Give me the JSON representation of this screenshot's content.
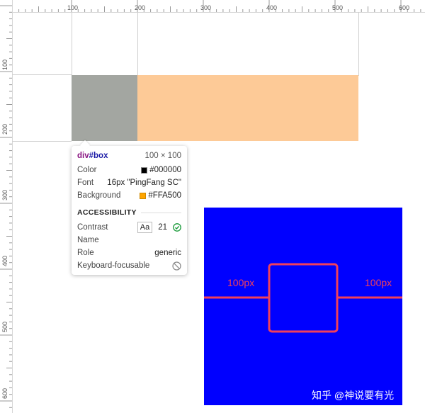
{
  "ruler": {
    "top_labels": [
      "100",
      "200",
      "300",
      "400",
      "500",
      "600"
    ],
    "left_labels": [
      "100",
      "200",
      "300",
      "400",
      "500",
      "600"
    ]
  },
  "tooltip": {
    "selector_tag": "div",
    "selector_id": "#box",
    "dimensions": "100 × 100",
    "rows": [
      {
        "label": "Color",
        "value": "#000000",
        "swatch": "#000000"
      },
      {
        "label": "Font",
        "value": "16px \"PingFang SC\""
      },
      {
        "label": "Background",
        "value": "#FFA500",
        "swatch": "#FFA500"
      }
    ],
    "accessibility_heading": "ACCESSIBILITY",
    "contrast_label": "Contrast",
    "contrast_badge": "Aa",
    "contrast_value": "21",
    "name_label": "Name",
    "role_label": "Role",
    "role_value": "generic",
    "keyboard_label": "Keyboard-focusable"
  },
  "colors": {
    "grey_box": "#A3A6A1",
    "orange_box": "#FDCA97",
    "diagram_bg": "#0000FF",
    "diagram_accent": "#F0405B",
    "check_green": "#1A9A3A"
  },
  "diagram": {
    "left_label": "100px",
    "right_label": "100px",
    "watermark": "知乎 @神说要有光"
  }
}
